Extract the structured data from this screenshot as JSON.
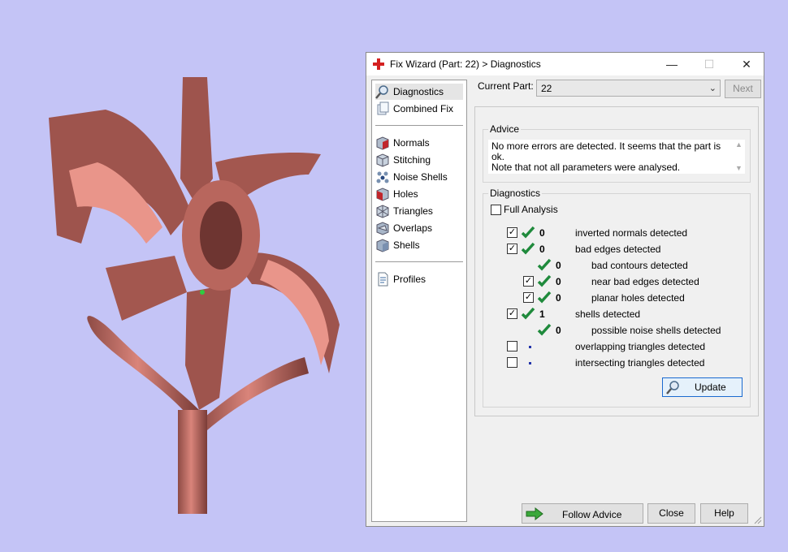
{
  "window": {
    "title": "Fix Wizard (Part: 22) > Diagnostics",
    "minimize": "—",
    "maximize": "☐",
    "close": "✕"
  },
  "nav": {
    "top": [
      "Diagnostics",
      "Combined Fix"
    ],
    "fixes": [
      "Normals",
      "Stitching",
      "Noise Shells",
      "Holes",
      "Triangles",
      "Overlaps",
      "Shells"
    ],
    "bottom": [
      "Profiles"
    ]
  },
  "header": {
    "current_part_label": "Current Part:",
    "current_part_value": "22",
    "next_label": "Next"
  },
  "advice": {
    "legend": "Advice",
    "line1": "No more errors are detected. It seems that the part is ok.",
    "line2": "Note that not all parameters were analysed."
  },
  "diagnostics": {
    "legend": "Diagnostics",
    "full_analysis": "Full Analysis",
    "rows": [
      {
        "count": "0",
        "label": "inverted normals detected"
      },
      {
        "count": "0",
        "label": "bad edges detected"
      },
      {
        "count": "0",
        "label": "bad contours detected"
      },
      {
        "count": "0",
        "label": "near bad edges detected"
      },
      {
        "count": "0",
        "label": "planar holes detected"
      },
      {
        "count": "1",
        "label": "shells detected"
      },
      {
        "count": "0",
        "label": "possible noise shells detected"
      },
      {
        "count": "",
        "label": "overlapping triangles detected"
      },
      {
        "count": "",
        "label": "intersecting triangles detected"
      }
    ],
    "update_label": "Update"
  },
  "footer": {
    "follow_advice": "Follow Advice",
    "close": "Close",
    "help": "Help"
  },
  "colors": {
    "viewport": "#c4c4f6",
    "model": "#b5685e",
    "model_light": "#e9958a",
    "check": "#1f8a3c"
  }
}
